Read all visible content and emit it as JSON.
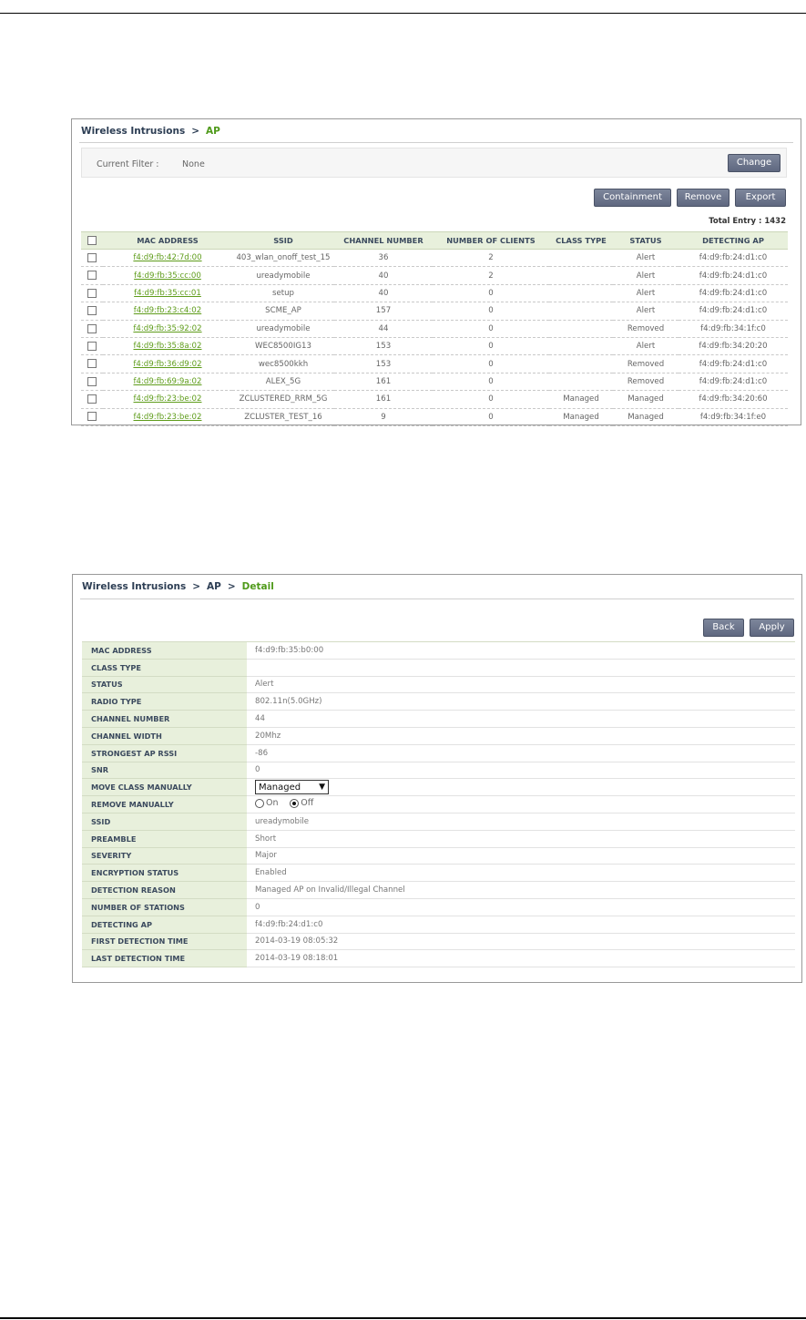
{
  "list_panel": {
    "breadcrumb": {
      "root": "Wireless Intrusions",
      "separator": ">",
      "current": "AP"
    },
    "filter": {
      "label": "Current Filter :",
      "value": "None",
      "change_label": "Change"
    },
    "actions": {
      "containment": "Containment",
      "remove": "Remove",
      "export": "Export"
    },
    "total_entry": "Total Entry : 1432",
    "columns": [
      "MAC ADDRESS",
      "SSID",
      "CHANNEL NUMBER",
      "NUMBER OF CLIENTS",
      "CLASS TYPE",
      "STATUS",
      "DETECTING AP"
    ],
    "rows": [
      {
        "mac": "f4:d9:fb:42:7d:00",
        "ssid": "403_wlan_onoff_test_15",
        "channel": "36",
        "clients": "2",
        "class_type": "",
        "status": "Alert",
        "detecting_ap": "f4:d9:fb:24:d1:c0"
      },
      {
        "mac": "f4:d9:fb:35:cc:00",
        "ssid": "ureadymobile",
        "channel": "40",
        "clients": "2",
        "class_type": "",
        "status": "Alert",
        "detecting_ap": "f4:d9:fb:24:d1:c0"
      },
      {
        "mac": "f4:d9:fb:35:cc:01",
        "ssid": "setup",
        "channel": "40",
        "clients": "0",
        "class_type": "",
        "status": "Alert",
        "detecting_ap": "f4:d9:fb:24:d1:c0"
      },
      {
        "mac": "f4:d9:fb:23:c4:02",
        "ssid": "SCME_AP",
        "channel": "157",
        "clients": "0",
        "class_type": "",
        "status": "Alert",
        "detecting_ap": "f4:d9:fb:24:d1:c0"
      },
      {
        "mac": "f4:d9:fb:35:92:02",
        "ssid": "ureadymobile",
        "channel": "44",
        "clients": "0",
        "class_type": "",
        "status": "Removed",
        "detecting_ap": "f4:d9:fb:34:1f:c0"
      },
      {
        "mac": "f4:d9:fb:35:8a:02",
        "ssid": "WEC8500IG13",
        "channel": "153",
        "clients": "0",
        "class_type": "",
        "status": "Alert",
        "detecting_ap": "f4:d9:fb:34:20:20"
      },
      {
        "mac": "f4:d9:fb:36:d9:02",
        "ssid": "wec8500kkh",
        "channel": "153",
        "clients": "0",
        "class_type": "",
        "status": "Removed",
        "detecting_ap": "f4:d9:fb:24:d1:c0"
      },
      {
        "mac": "f4:d9:fb:69:9a:02",
        "ssid": "ALEX_5G",
        "channel": "161",
        "clients": "0",
        "class_type": "",
        "status": "Removed",
        "detecting_ap": "f4:d9:fb:24:d1:c0"
      },
      {
        "mac": "f4:d9:fb:23:be:02",
        "ssid": "ZCLUSTERED_RRM_5G",
        "channel": "161",
        "clients": "0",
        "class_type": "Managed",
        "status": "Managed",
        "detecting_ap": "f4:d9:fb:34:20:60"
      },
      {
        "mac": "f4:d9:fb:23:be:02",
        "ssid": "ZCLUSTER_TEST_16",
        "channel": "9",
        "clients": "0",
        "class_type": "Managed",
        "status": "Managed",
        "detecting_ap": "f4:d9:fb:34:1f:e0"
      }
    ]
  },
  "detail_panel": {
    "breadcrumb": {
      "root": "Wireless Intrusions",
      "separator": ">",
      "middle": "AP",
      "current": "Detail"
    },
    "actions": {
      "back": "Back",
      "apply": "Apply"
    },
    "fields": [
      {
        "label": "MAC ADDRESS",
        "value": "f4:d9:fb:35:b0:00"
      },
      {
        "label": "CLASS TYPE",
        "value": ""
      },
      {
        "label": "STATUS",
        "value": "Alert"
      },
      {
        "label": "RADIO TYPE",
        "value": "802.11n(5.0GHz)"
      },
      {
        "label": "CHANNEL NUMBER",
        "value": "44"
      },
      {
        "label": "CHANNEL WIDTH",
        "value": "20Mhz"
      },
      {
        "label": "STRONGEST AP RSSI",
        "value": "-86"
      },
      {
        "label": "SNR",
        "value": "0"
      },
      {
        "label": "MOVE CLASS MANUALLY",
        "type": "select",
        "value": "Managed"
      },
      {
        "label": "REMOVE MANUALLY",
        "type": "radio",
        "options": [
          "On",
          "Off"
        ],
        "selected": "Off"
      },
      {
        "label": "SSID",
        "value": "ureadymobile"
      },
      {
        "label": "PREAMBLE",
        "value": "Short"
      },
      {
        "label": "SEVERITY",
        "value": "Major"
      },
      {
        "label": "ENCRYPTION STATUS",
        "value": "Enabled"
      },
      {
        "label": "DETECTION REASON",
        "value": "Managed AP on Invalid/Illegal Channel"
      },
      {
        "label": "NUMBER OF STATIONS",
        "value": "0"
      },
      {
        "label": "DETECTING AP",
        "value": "f4:d9:fb:24:d1:c0"
      },
      {
        "label": "FIRST DETECTION TIME",
        "value": "2014-03-19 08:05:32"
      },
      {
        "label": "LAST DETECTION TIME",
        "value": "2014-03-19 08:18:01"
      }
    ]
  },
  "colors": {
    "accent_green": "#4f9a1a",
    "header_green": "#e8f0dc",
    "button": "#6a7389",
    "breadcrumb": "#2d3e54"
  }
}
